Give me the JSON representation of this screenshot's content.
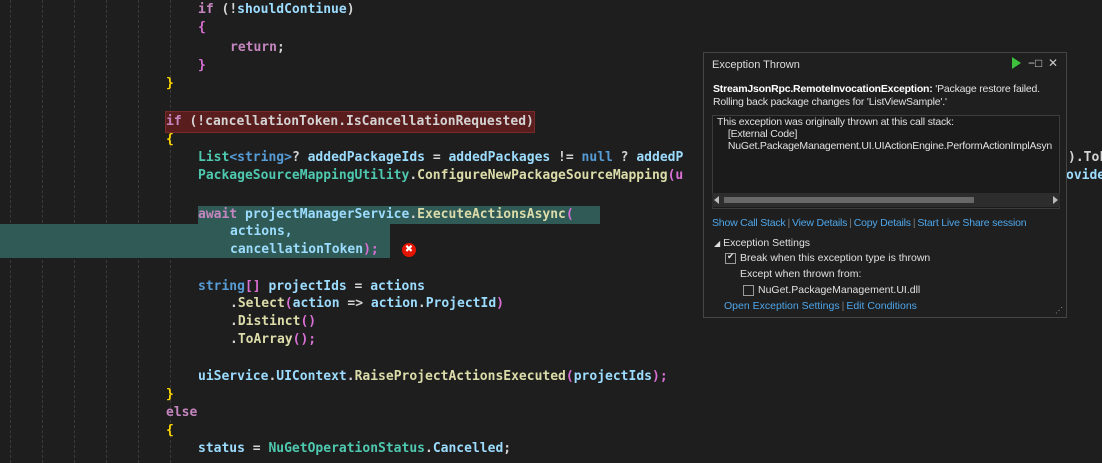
{
  "editor": {
    "lines": {
      "l1_kw": "if",
      "l1_rest_a": " (",
      "l1_not": "!",
      "l1_var": "shouldContinue",
      "l1_close": ")",
      "l2": "{",
      "l3_kw": "return",
      "l3_end": ";",
      "l4": "}",
      "l5": "}",
      "l6_kw": "if",
      "l6_rest": " (!cancellationToken.IsCancellationRequested)",
      "l7": "{",
      "l8_type": "List",
      "l8_gen": "<string>",
      "l8_q": "? ",
      "l8_var": "addedPackageIds",
      "l8_eq": " = ",
      "l8_var2": "addedPackages",
      "l8_ne": " != ",
      "l8_null": "null",
      "l8_tern": " ? ",
      "l8_var3": "addedP",
      "l8_tail": ").ToL",
      "l9_type": "PackageSourceMappingUtility",
      "l9_dot": ".",
      "l9_fn": "ConfigureNewPackageSourceMapping",
      "l9_paren": "(u",
      "l9_tail": "ovide",
      "l10_kw": "await",
      "l10_sp": " ",
      "l10_var": "projectManagerService",
      "l10_dot": ".",
      "l10_fn": "ExecuteActionsAsync",
      "l10_paren": "(",
      "l11": "actions,",
      "l12_a": "cancellationToken",
      "l12_b": ");",
      "l13_kw": "string",
      "l13_br": "[]",
      "l13_sp": " ",
      "l13_var": "projectIds",
      "l13_eq": " = ",
      "l13_var2": "actions",
      "l14_dot": ".",
      "l14_fn": "Select",
      "l14_p": "(",
      "l14_var": "action",
      "l14_arrow": " => ",
      "l14_var2": "action",
      "l14_dot2": ".",
      "l14_prop": "ProjectId",
      "l14_close": ")",
      "l15_dot": ".",
      "l15_fn": "Distinct",
      "l15_p": "()",
      "l16_dot": ".",
      "l16_fn": "ToArray",
      "l16_p": "();",
      "l17_var": "uiService",
      "l17_dot": ".",
      "l17_ctx": "UIContext",
      "l17_dot2": ".",
      "l17_fn": "RaiseProjectActionsExecuted",
      "l17_p": "(",
      "l17_arg": "projectIds",
      "l17_end": ");",
      "l18": "}",
      "l19_kw": "else",
      "l20": "{",
      "l21_var": "status",
      "l21_eq": " = ",
      "l21_type": "NuGetOperationStatus",
      "l21_dot": ".",
      "l21_val": "Cancelled",
      "l21_end": ";"
    },
    "error_glyph": "✖"
  },
  "popup": {
    "title": "Exception Thrown",
    "pin_glyph": "−□",
    "close_glyph": "✕",
    "exception_type": "StreamJsonRpc.RemoteInvocationException:",
    "exception_msg_1": " 'Package restore failed.",
    "exception_msg_2": "Rolling back package changes for 'ListViewSample'.'",
    "stack_header": "This exception was originally thrown at this call stack:",
    "stack_line_1": "    [External Code]",
    "stack_line_2": "    NuGet.PackageManagement.UI.UIActionEngine.PerformActionImplAsyn",
    "links": {
      "show_call_stack": "Show Call Stack",
      "view_details": "View Details",
      "copy_details": "Copy Details",
      "live_share": "Start Live Share session",
      "sep": "|"
    },
    "settings": {
      "header": "Exception Settings",
      "break_when": "Break when this exception type is thrown",
      "except_when": "Except when thrown from:",
      "module": "NuGet.PackageManagement.UI.dll",
      "break_checked": true,
      "module_checked": false,
      "open_settings": "Open Exception Settings",
      "edit_conditions": "Edit Conditions"
    },
    "grip_glyph": "⋰"
  }
}
